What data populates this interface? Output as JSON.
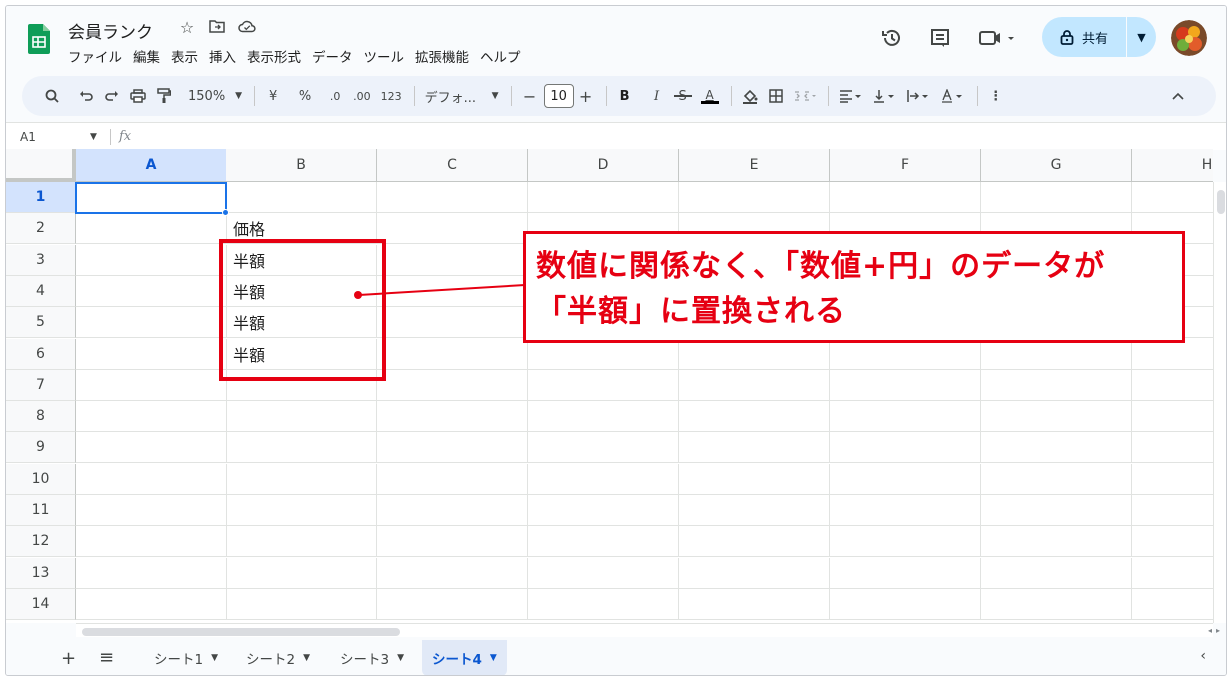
{
  "app": {
    "icon": "sheets-logo-icon"
  },
  "document": {
    "title": "会員ランク"
  },
  "menu": [
    "ファイル",
    "編集",
    "表示",
    "挿入",
    "表示形式",
    "データ",
    "ツール",
    "拡張機能",
    "ヘルプ"
  ],
  "header": {
    "share_label": "共有"
  },
  "toolbar": {
    "zoom": "150%",
    "currency": "¥",
    "percent": "%",
    "decrease_decimal": ".0",
    "increase_decimal": ".00",
    "number_format": "123",
    "font": "デフォ...",
    "minus": "−",
    "font_size": "10",
    "plus": "+",
    "bold": "B",
    "italic": "I",
    "strike": "S",
    "text_color": "A"
  },
  "formula_bar": {
    "cell_ref": "A1",
    "fx": "fx",
    "value": ""
  },
  "grid": {
    "columns": [
      "A",
      "B",
      "C",
      "D",
      "E",
      "F",
      "G",
      "H"
    ],
    "rows": [
      "1",
      "2",
      "3",
      "4",
      "5",
      "6",
      "7",
      "8",
      "9",
      "10",
      "11",
      "12",
      "13",
      "14"
    ],
    "selected_cell": "A1",
    "cells": {
      "B2": "価格",
      "B3": "半額",
      "B4": "半額",
      "B5": "半額",
      "B6": "半額"
    }
  },
  "annotation": {
    "line1": "数値に関係なく、「数値+円」のデータが",
    "line2": "「半額」に置換される",
    "color": "#e60012"
  },
  "sheets": {
    "tabs": [
      "シート1",
      "シート2",
      "シート3",
      "シート4"
    ],
    "active": "シート4"
  },
  "colors": {
    "accent": "#0b57d0",
    "share_bg": "#c2e7ff",
    "selection": "#1a73e8"
  }
}
